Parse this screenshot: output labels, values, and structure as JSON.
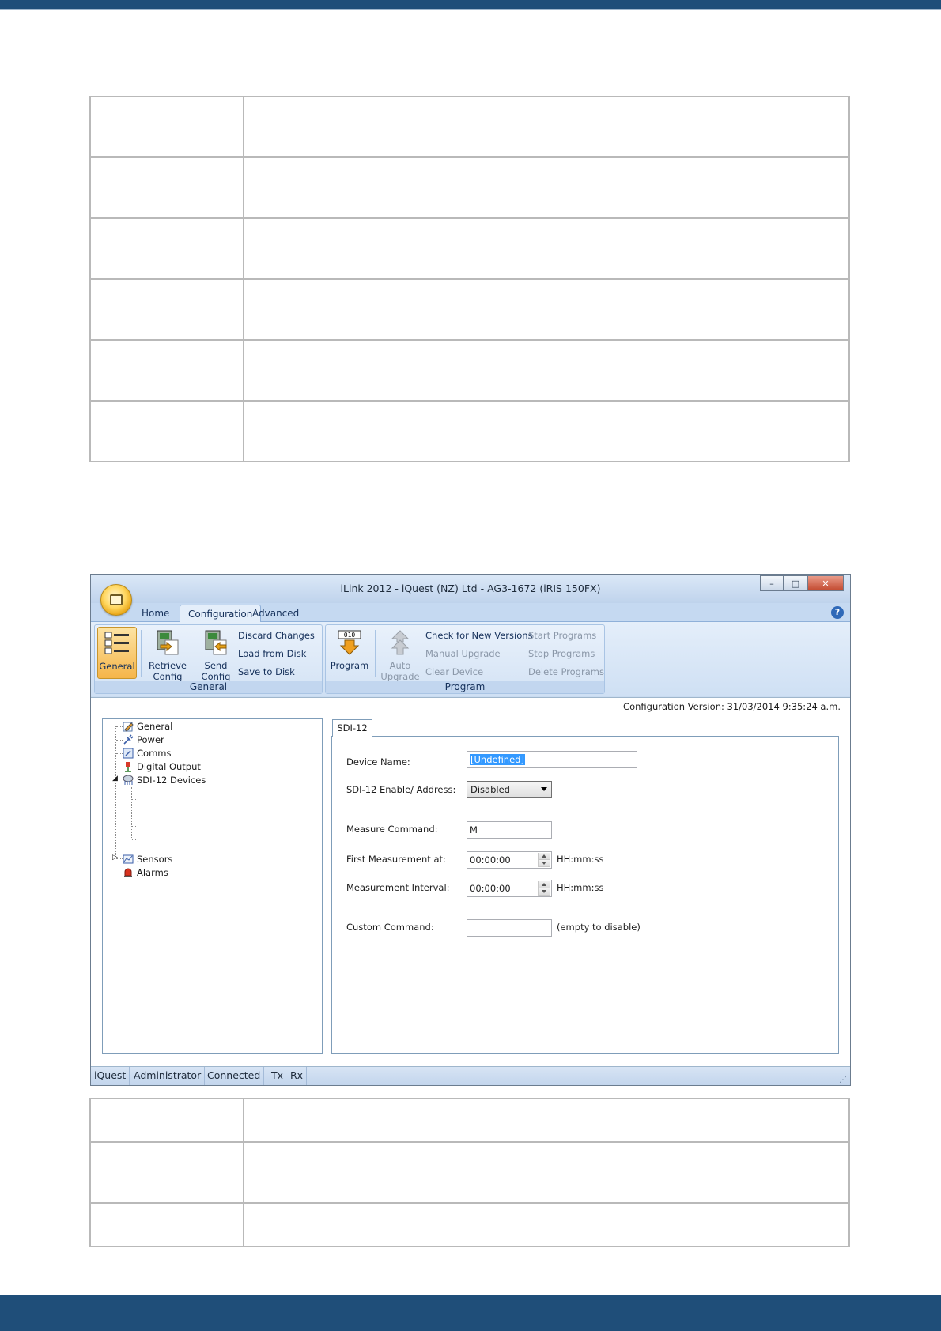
{
  "window": {
    "title": "iLink 2012 - iQuest (NZ) Ltd - AG3-1672 (iRIS 150FX)",
    "controls": {
      "minimize": "–",
      "restore": "□",
      "close": "✕"
    }
  },
  "ribbon_tabs": [
    "Home",
    "Configuration",
    "Advanced"
  ],
  "ribbon": {
    "general_group": {
      "caption": "General",
      "general": "General",
      "retrieve": [
        "Retrieve",
        "Config"
      ],
      "send": [
        "Send",
        "Config"
      ],
      "discard": "Discard Changes",
      "load": "Load from Disk",
      "save": "Save to Disk"
    },
    "program_group": {
      "caption": "Program",
      "program": "Program",
      "auto_upgrade": [
        "Auto",
        "Upgrade"
      ],
      "check_versions": "Check for New Versions",
      "manual_upgrade": "Manual Upgrade",
      "clear_device": "Clear Device",
      "start_programs": "Start Programs",
      "stop_programs": "Stop Programs",
      "delete_programs": "Delete Programs"
    }
  },
  "config_version": "Configuration Version: 31/03/2014 9:35:24 a.m.",
  "tree": {
    "general": "General",
    "power": "Power",
    "comms": "Comms",
    "digital_output": "Digital Output",
    "sdi12_devices": "SDI-12 Devices",
    "sensors": "Sensors",
    "alarms": "Alarms"
  },
  "panel": {
    "tab": "SDI-12",
    "device_name_label": "Device Name:",
    "device_name_value": "[Undefined]",
    "sdi_enable_label": "SDI-12 Enable/ Address:",
    "sdi_enable_value": "Disabled",
    "measure_cmd_label": "Measure Command:",
    "measure_cmd_value": "M",
    "first_meas_label": "First Measurement at:",
    "first_meas_value": "00:00:00",
    "first_meas_unit": "HH:mm:ss",
    "interval_label": "Measurement Interval:",
    "interval_value": "00:00:00",
    "interval_unit": "HH:mm:ss",
    "custom_cmd_label": "Custom Command:",
    "custom_cmd_value": "",
    "custom_cmd_hint": "(empty to disable)"
  },
  "status": [
    "iQuest",
    "Administrator",
    "Connected",
    "Tx",
    "Rx"
  ],
  "colors": {
    "header_band": "#1f4e79",
    "ribbon_bg": "#cfe0f4",
    "active_button": "#f5b54a"
  }
}
